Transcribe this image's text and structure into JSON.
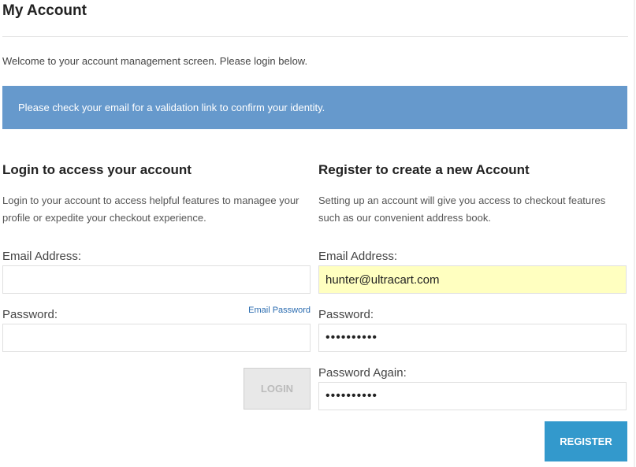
{
  "page": {
    "title": "My Account",
    "welcome": "Welcome to your account management screen. Please login below.",
    "alert": "Please check your email for a validation link to confirm your identity."
  },
  "login": {
    "title": "Login to access your account",
    "description": "Login to your account to access helpful features to managee your profile or expedite your checkout experience.",
    "email_label": "Email Address:",
    "email_value": "",
    "password_label": "Password:",
    "password_value": "",
    "email_password_link": "Email Password",
    "button_label": "LOGIN"
  },
  "register": {
    "title": "Register to create a new Account",
    "description": "Setting up an account will give you access to checkout features such as our convenient address book.",
    "email_label": "Email Address:",
    "email_value": "hunter@ultracart.com",
    "password_label": "Password:",
    "password_value": "••••••••••",
    "password_again_label": "Password Again:",
    "password_again_value": "••••••••••",
    "button_label": "REGISTER"
  },
  "colors": {
    "alert_bg": "#6699cc",
    "register_button_bg": "#3399cc",
    "autofill_bg": "#ffffc0",
    "login_button_bg": "#e8e8e8"
  }
}
